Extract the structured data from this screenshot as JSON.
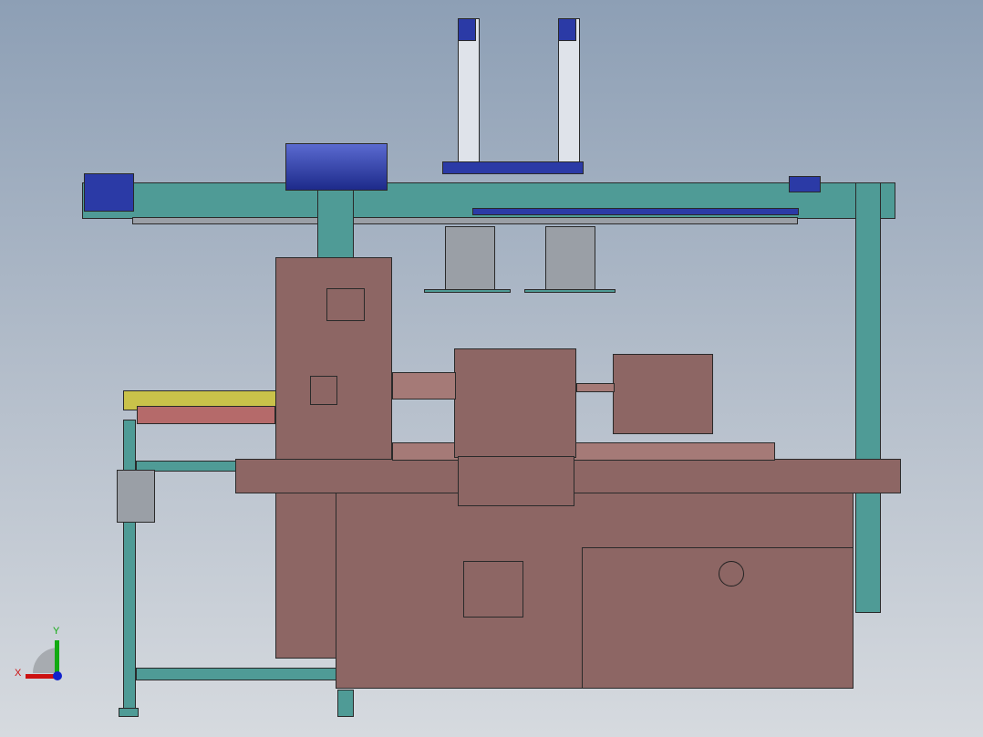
{
  "viewport": {
    "type": "cad-3d-model-view"
  },
  "triad": {
    "x_label": "X",
    "y_label": "Y",
    "x_color": "#cc1111",
    "y_color": "#11aa11",
    "z_color": "#1122cc"
  },
  "colors": {
    "frame": "#4f9b96",
    "cabinet": "#8d6664",
    "actuator": "#2b3aa6",
    "feeder": "#c9c24a"
  }
}
